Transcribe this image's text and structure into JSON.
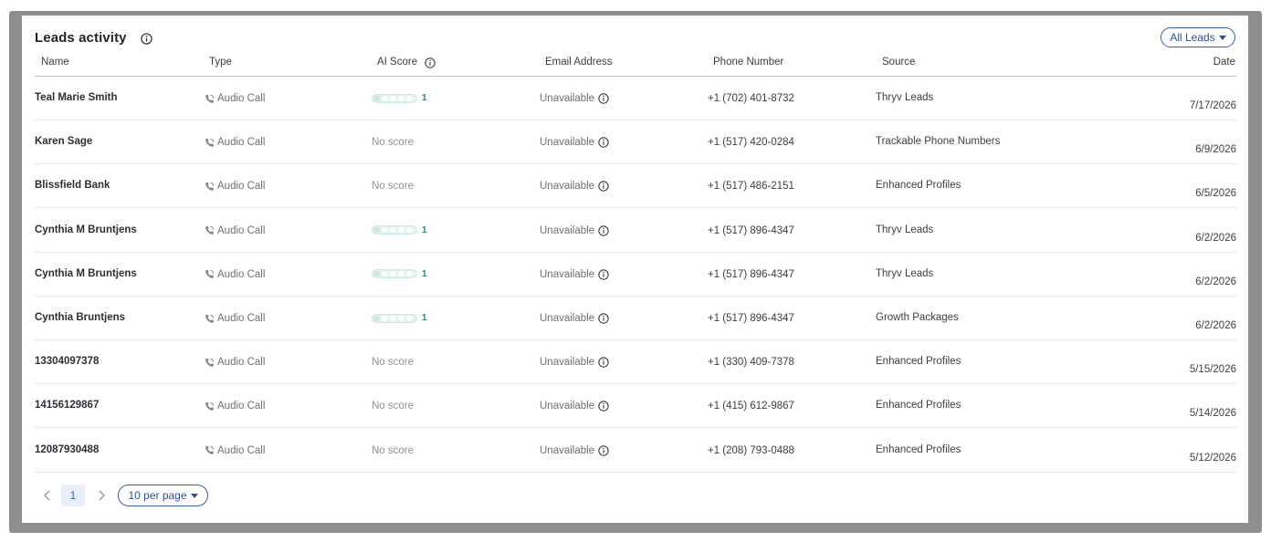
{
  "panel": {
    "title": "Leads activity",
    "filter_label": "All Leads"
  },
  "columns": [
    "Name",
    "Type",
    "AI Score",
    "Email Address",
    "Phone Number",
    "Source",
    "Date"
  ],
  "rows": [
    {
      "name": "Teal Marie Smith",
      "type": "Audio Call",
      "score": "1",
      "has_score": true,
      "email": "Unavailable",
      "phone": "+1 (702) 401-8732",
      "source": "Thryv Leads",
      "date": "7/17/2026"
    },
    {
      "name": "Karen Sage",
      "type": "Audio Call",
      "score": "No score",
      "has_score": false,
      "email": "Unavailable",
      "phone": "+1 (517) 420-0284",
      "source": "Trackable Phone Numbers",
      "date": "6/9/2026"
    },
    {
      "name": "Blissfield Bank",
      "type": "Audio Call",
      "score": "No score",
      "has_score": false,
      "email": "Unavailable",
      "phone": "+1 (517) 486-2151",
      "source": "Enhanced Profiles",
      "date": "6/5/2026"
    },
    {
      "name": "Cynthia M Bruntjens",
      "type": "Audio Call",
      "score": "1",
      "has_score": true,
      "email": "Unavailable",
      "phone": "+1 (517) 896-4347",
      "source": "Thryv Leads",
      "date": "6/2/2026"
    },
    {
      "name": "Cynthia M Bruntjens",
      "type": "Audio Call",
      "score": "1",
      "has_score": true,
      "email": "Unavailable",
      "phone": "+1 (517) 896-4347",
      "source": "Thryv Leads",
      "date": "6/2/2026"
    },
    {
      "name": "Cynthia Bruntjens",
      "type": "Audio Call",
      "score": "1",
      "has_score": true,
      "email": "Unavailable",
      "phone": "+1 (517) 896-4347",
      "source": "Growth Packages",
      "date": "6/2/2026"
    },
    {
      "name": "13304097378",
      "type": "Audio Call",
      "score": "No score",
      "has_score": false,
      "email": "Unavailable",
      "phone": "+1 (330) 409-7378",
      "source": "Enhanced Profiles",
      "date": "5/15/2026"
    },
    {
      "name": "14156129867",
      "type": "Audio Call",
      "score": "No score",
      "has_score": false,
      "email": "Unavailable",
      "phone": "+1 (415) 612-9867",
      "source": "Enhanced Profiles",
      "date": "5/14/2026"
    },
    {
      "name": "12087930488",
      "type": "Audio Call",
      "score": "No score",
      "has_score": false,
      "email": "Unavailable",
      "phone": "+1 (208) 793-0488",
      "source": "Enhanced Profiles",
      "date": "5/12/2026"
    }
  ],
  "pagination": {
    "current_page": "1",
    "per_page_label": "10 per page"
  },
  "colors": {
    "accent": "#2d4f9a",
    "score_green": "#2e8b57"
  },
  "icons": {
    "info": "info-circle-icon",
    "call": "phone-call-icon",
    "prev": "chevron-left-icon",
    "next": "chevron-right-icon",
    "caret": "caret-down-icon"
  }
}
